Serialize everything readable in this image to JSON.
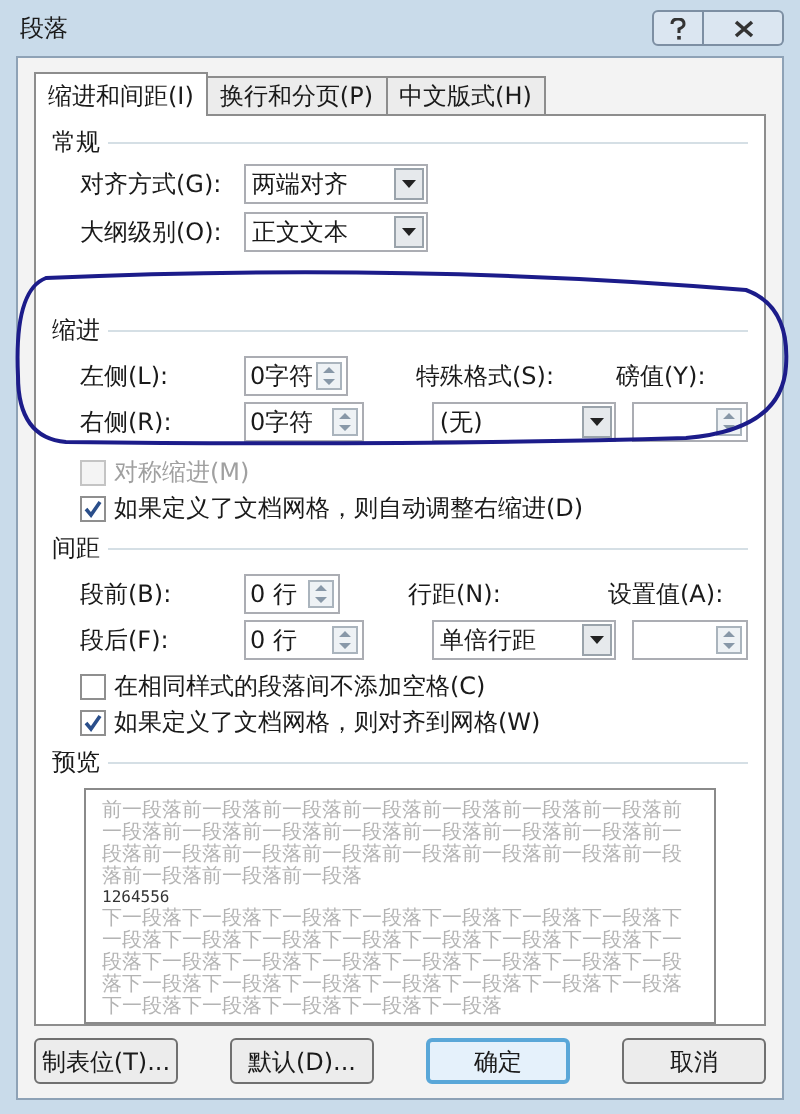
{
  "window": {
    "title": "段落"
  },
  "tabs": [
    {
      "label": "缩进和间距(I)",
      "selected": true
    },
    {
      "label": "换行和分页(P)",
      "selected": false
    },
    {
      "label": "中文版式(H)",
      "selected": false
    }
  ],
  "general": {
    "heading": "常规",
    "rows": [
      {
        "label": "对齐方式(G):",
        "value": "两端对齐"
      },
      {
        "label": "大纲级别(O):",
        "value": "正文文本"
      }
    ]
  },
  "indent": {
    "heading": "缩进",
    "left": {
      "label": "左侧(L):",
      "value": "0字符"
    },
    "right": {
      "label": "右侧(R):",
      "value": "0字符"
    },
    "special": {
      "label": "特殊格式(S):",
      "value": "(无)"
    },
    "by": {
      "label": "磅值(Y):"
    },
    "checkboxes": [
      {
        "label": "对称缩进(M)",
        "checked": false,
        "disabled": true
      },
      {
        "label": "如果定义了文档网格，则自动调整右缩进(D)",
        "checked": true,
        "disabled": false
      }
    ]
  },
  "spacing": {
    "heading": "间距",
    "before": {
      "label": "段前(B):",
      "value": "0 行"
    },
    "after": {
      "label": "段后(F):",
      "value": "0 行"
    },
    "line": {
      "label": "行距(N):",
      "value": "单倍行距"
    },
    "at": {
      "label": "设置值(A):"
    },
    "checkboxes": [
      {
        "label": "在相同样式的段落间不添加空格(C)",
        "checked": false,
        "disabled": false
      },
      {
        "label": "如果定义了文档网格，则对齐到网格(W)",
        "checked": true,
        "disabled": false
      }
    ]
  },
  "preview": {
    "heading": "预览",
    "previous": "前一段落前一段落前一段落前一段落前一段落前一段落前一段落前一段落前一段落前一段落前一段落前一段落前一段落前一段落前一段落前一段落前一段落前一段落前一段落前一段落前一段落前一段落前一段落前一段落前一段落",
    "sample": "1264556",
    "next": "下一段落下一段落下一段落下一段落下一段落下一段落下一段落下一段落下一段落下一段落下一段落下一段落下一段落下一段落下一段落下一段落下一段落下一段落下一段落下一段落下一段落下一段落下一段落下一段落下一段落下一段落下一段落下一段落下一段落下一段落下一段落下一段落下一段落下一段落"
  },
  "buttons": [
    {
      "label": "制表位(T)...",
      "default": false
    },
    {
      "label": "默认(D)...",
      "default": false
    },
    {
      "label": "确定",
      "default": true
    },
    {
      "label": "取消",
      "default": false
    }
  ]
}
